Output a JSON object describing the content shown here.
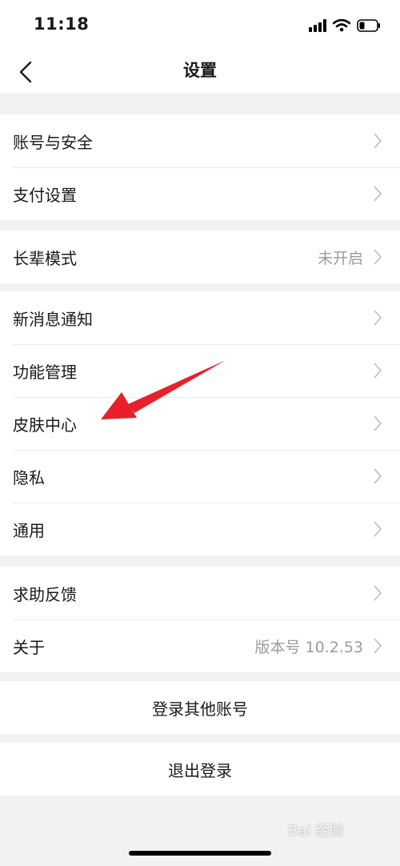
{
  "status_bar": {
    "time": "11:18",
    "icons": [
      "signal-icon",
      "wifi-icon",
      "battery-icon"
    ]
  },
  "nav": {
    "title": "设置",
    "back_icon": "chevron-left-icon"
  },
  "groups": [
    {
      "items": [
        {
          "label": "账号与安全"
        },
        {
          "label": "支付设置"
        }
      ]
    },
    {
      "items": [
        {
          "label": "长辈模式",
          "value": "未开启"
        }
      ]
    },
    {
      "items": [
        {
          "label": "新消息通知"
        },
        {
          "label": "功能管理"
        },
        {
          "label": "皮肤中心"
        },
        {
          "label": "隐私"
        },
        {
          "label": "通用"
        }
      ]
    },
    {
      "items": [
        {
          "label": "求助反馈"
        },
        {
          "label": "关于",
          "value": "版本号 10.2.53"
        }
      ]
    }
  ],
  "buttons": {
    "switch_account": "登录其他账号",
    "logout": "退出登录"
  },
  "annotation": {
    "color": "#e8202a",
    "target": "皮肤中心"
  },
  "watermark": "Bai 经验"
}
